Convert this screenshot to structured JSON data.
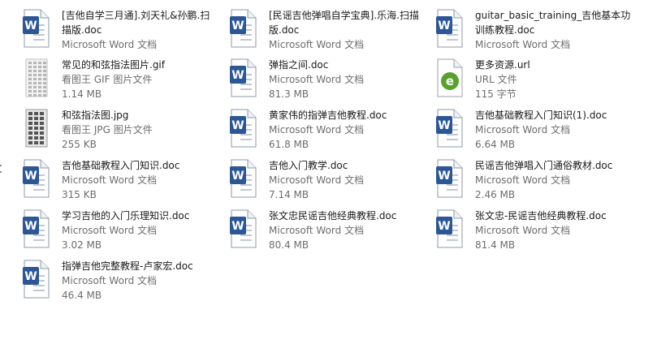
{
  "colors": {
    "name_text": "#1a1a1a",
    "meta_text": "#6d6d6d",
    "word_blue": "#2b5797",
    "url_green": "#5aa02c",
    "background": "#ffffff"
  },
  "files": [
    {
      "name": "[吉他自学三月通].刘天礼&孙鹏.扫\n描版.doc",
      "type": "Microsoft Word 文档",
      "size": "",
      "icon": "word-doc-icon"
    },
    {
      "name": "[民谣吉他弹唱自学宝典].乐海.扫描\n版.doc",
      "type": "Microsoft Word 文档",
      "size": "",
      "icon": "word-doc-icon"
    },
    {
      "name": "guitar_basic_training_吉他基本功\n训练教程.doc",
      "type": "Microsoft Word 文档",
      "size": "",
      "icon": "word-doc-icon"
    },
    {
      "name": "常见的和弦指法图片.gif",
      "type": "看图王 GIF 图片文件",
      "size": "1.14 MB",
      "icon": "gif-image-icon"
    },
    {
      "name": "弹指之间.doc",
      "type": "Microsoft Word 文档",
      "size": "81.3 MB",
      "icon": "word-doc-icon"
    },
    {
      "name": "更多资源.url",
      "type": "URL 文件",
      "size": "115 字节",
      "icon": "url-shortcut-icon"
    },
    {
      "name": "和弦指法图.jpg",
      "type": "看图王 JPG 图片文件",
      "size": "255 KB",
      "icon": "jpg-image-icon"
    },
    {
      "name": "黄家伟的指弹吉他教程.doc",
      "type": "Microsoft Word 文档",
      "size": "61.8 MB",
      "icon": "word-doc-icon"
    },
    {
      "name": "吉他基础教程入门知识(1).doc",
      "type": "Microsoft Word 文档",
      "size": "6.64 MB",
      "icon": "word-doc-icon"
    },
    {
      "name": "吉他基础教程入门知识.doc",
      "type": "Microsoft Word 文档",
      "size": "315 KB",
      "icon": "word-doc-icon"
    },
    {
      "name": "吉他入门教学.doc",
      "type": "Microsoft Word 文档",
      "size": "7.14 MB",
      "icon": "word-doc-icon"
    },
    {
      "name": "民谣吉他弹唱入门通俗教材.doc",
      "type": "Microsoft Word 文档",
      "size": "2.46 MB",
      "icon": "word-doc-icon"
    },
    {
      "name": "学习吉他的入门乐理知识.doc",
      "type": "Microsoft Word 文档",
      "size": "3.02 MB",
      "icon": "word-doc-icon"
    },
    {
      "name": "张文忠民谣吉他经典教程.doc",
      "type": "Microsoft Word 文档",
      "size": "80.4 MB",
      "icon": "word-doc-icon"
    },
    {
      "name": "张文忠-民谣吉他经典教程.doc",
      "type": "Microsoft Word 文档",
      "size": "81.4 MB",
      "icon": "word-doc-icon"
    },
    {
      "name": "指弹吉他完整教程-卢家宏.doc",
      "type": "Microsoft Word 文档",
      "size": "46.4 MB",
      "icon": "word-doc-icon"
    }
  ]
}
